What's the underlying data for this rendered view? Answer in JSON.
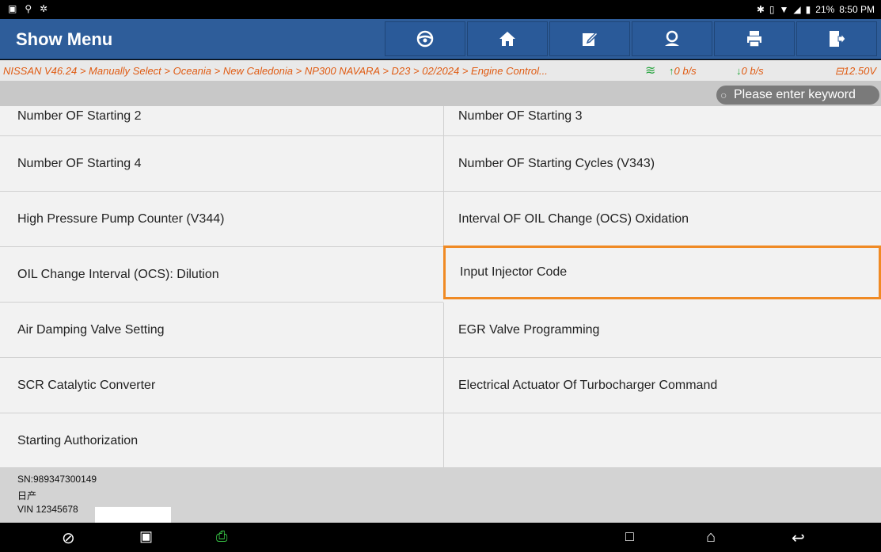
{
  "statusbar": {
    "battery": "21%",
    "time": "8:50 PM"
  },
  "header": {
    "title": "Show Menu"
  },
  "breadcrumb": {
    "path": "NISSAN V46.24 > Manually Select > Oceania > New Caledonia > NP300 NAVARA > D23 > 02/2024 > Engine Control...",
    "upload": "0 b/s",
    "download": "0 b/s",
    "voltage": "12.50V"
  },
  "search": {
    "placeholder": "Please enter keyword"
  },
  "menu": {
    "partial_left": "Number OF Starting 2",
    "partial_right": "Number OF Starting 3",
    "rows": [
      {
        "left": "Number OF Starting 4",
        "right": "Number OF Starting Cycles (V343)"
      },
      {
        "left": "High Pressure Pump Counter (V344)",
        "right": "Interval OF OIL Change (OCS) Oxidation"
      },
      {
        "left": "OIL Change Interval (OCS): Dilution",
        "right": "Input Injector Code"
      },
      {
        "left": "Air Damping Valve Setting",
        "right": "EGR Valve Programming"
      },
      {
        "left": "SCR Catalytic Converter",
        "right": "Electrical Actuator Of Turbocharger Command"
      },
      {
        "left": "Starting Authorization",
        "right": ""
      }
    ]
  },
  "footer": {
    "sn": "SN:989347300149",
    "brand": "日产",
    "vin": "VIN 12345678"
  },
  "colors": {
    "header": "#2e5d9a",
    "accent": "#f08a24",
    "breadcrumb_text": "#e05b12"
  }
}
